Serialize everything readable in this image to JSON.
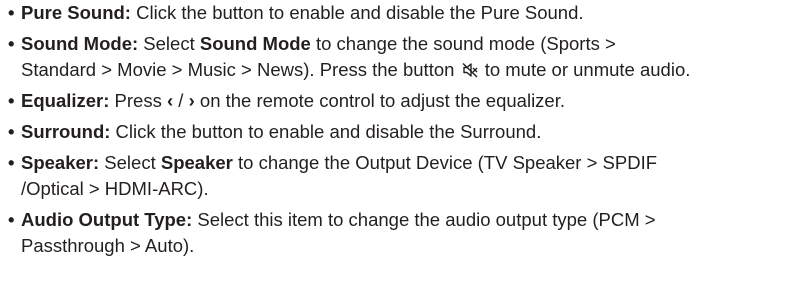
{
  "items": [
    {
      "term": "Pure Sound:",
      "text": " Click the button to enable and disable the Pure Sound."
    },
    {
      "term": "Sound Mode:",
      "text_a": " Select ",
      "strong": "Sound Mode",
      "text_b": " to change the sound mode (Sports >",
      "line2_a": "Standard > Movie > Music > News). Press the button ",
      "icon": "mute-speaker-icon",
      "line2_b": " to mute or unmute audio."
    },
    {
      "term": "Equalizer:",
      "text_a": " Press ",
      "glyph_left": "‹",
      "slash": " / ",
      "glyph_right": "›",
      "text_b": " on the remote control to adjust the equalizer."
    },
    {
      "term": "Surround:",
      "text": " Click the button to enable and disable the Surround."
    },
    {
      "term": "Speaker:",
      "text_a": " Select ",
      "strong": "Speaker",
      "text_b": " to change the Output Device (TV Speaker > SPDIF",
      "line2": "/Optical > HDMI-ARC)."
    },
    {
      "term": "Audio Output Type:",
      "text": " Select this item to change the audio output type (PCM >",
      "line2": "Passthrough > Auto)."
    }
  ]
}
